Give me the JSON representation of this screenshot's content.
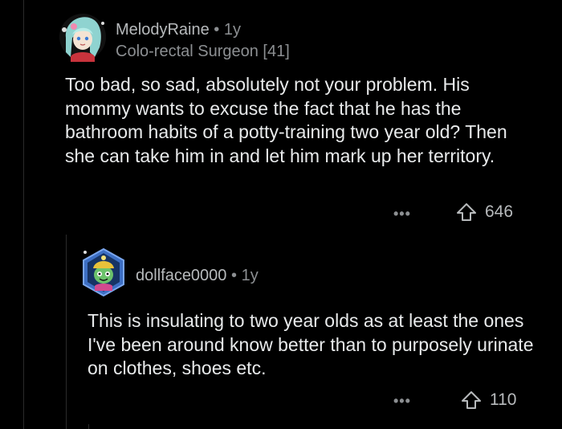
{
  "comments": [
    {
      "username": "MelodyRaine",
      "separator": "•",
      "age": "1y",
      "flair": "Colo-rectal Surgeon [41]",
      "body": "Too bad, so sad, absolutely not your problem.  His mommy wants to excuse the fact that he has the bathroom habits of a potty-training two year old? Then she can take him in and let him mark up her territory.",
      "more_label": "•••",
      "upvotes": "646",
      "avatar_icon": "avatar-illustration"
    },
    {
      "username": "dollface0000",
      "separator": "•",
      "age": "1y",
      "body": "This is insulating to two year olds as at least the ones I've been around know better than to purposely urinate on clothes, shoes etc.",
      "more_label": "•••",
      "upvotes": "110",
      "avatar_icon": "avatar-illustration"
    }
  ],
  "colors": {
    "background": "#000000",
    "text": "#e8eaeb",
    "meta": "#8c8f92",
    "thread_line": "#2a2a2a"
  }
}
